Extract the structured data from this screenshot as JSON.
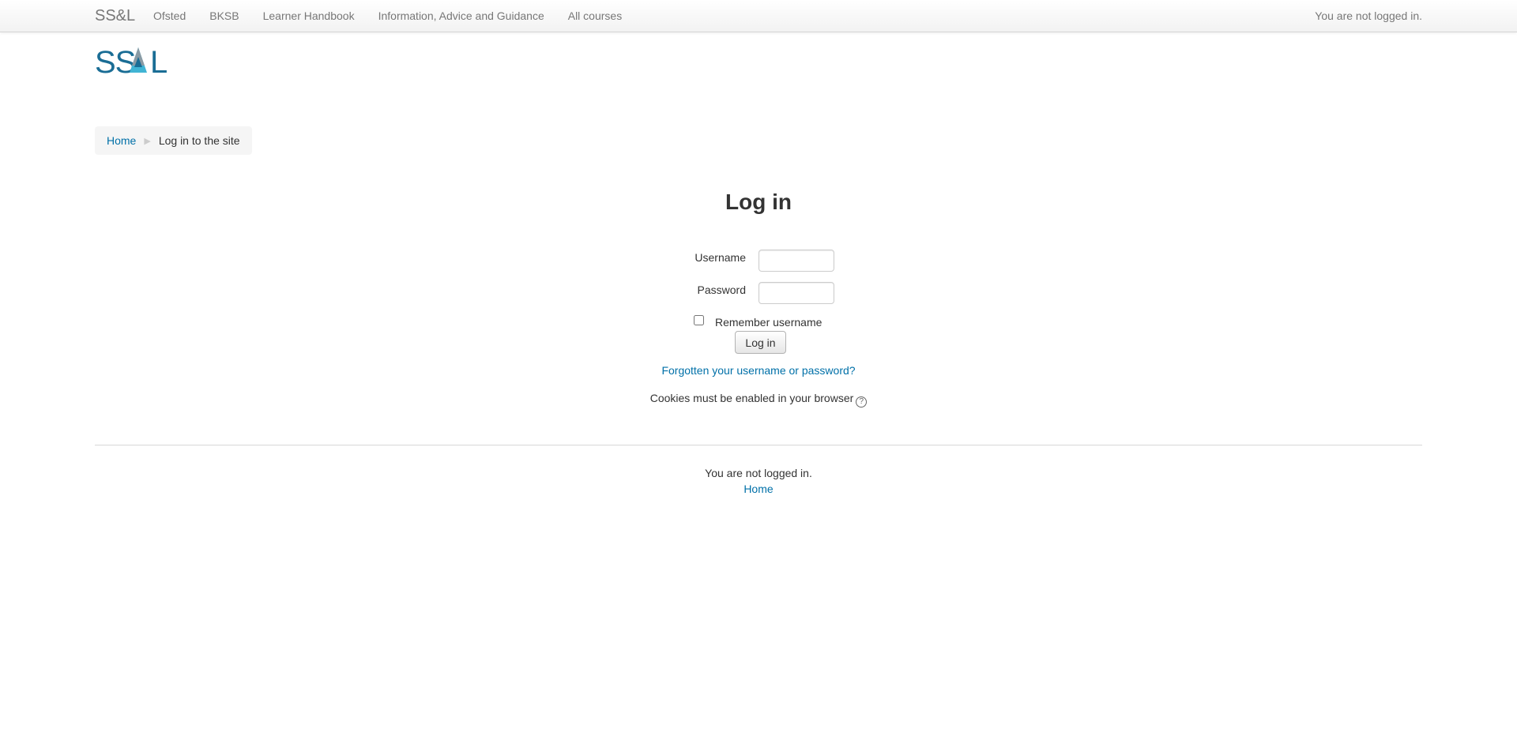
{
  "navbar": {
    "brand": "SS&L",
    "items": [
      {
        "label": "Ofsted"
      },
      {
        "label": "BKSB"
      },
      {
        "label": "Learner Handbook"
      },
      {
        "label": "Information, Advice and Guidance"
      },
      {
        "label": "All courses"
      }
    ],
    "login_info": "You are not logged in."
  },
  "logo": {
    "text": "SSAL",
    "colors": {
      "primary": "#1a6d95",
      "accent": "#40b4d4",
      "grey": "#8a9aa4"
    }
  },
  "breadcrumb": {
    "home": "Home",
    "separator": "▶",
    "current": "Log in to the site"
  },
  "login": {
    "title": "Log in",
    "username_label": "Username",
    "username_value": "",
    "password_label": "Password",
    "password_value": "",
    "remember_label": "Remember username",
    "remember_checked": false,
    "submit_label": "Log in",
    "forgot_link": "Forgotten your username or password?",
    "cookies_notice": "Cookies must be enabled in your browser",
    "help_icon": "question-circle-icon"
  },
  "footer": {
    "login_info": "You are not logged in.",
    "home_link": "Home"
  },
  "colors": {
    "link": "#0070a8",
    "text": "#333333",
    "nav_text": "#777777"
  }
}
